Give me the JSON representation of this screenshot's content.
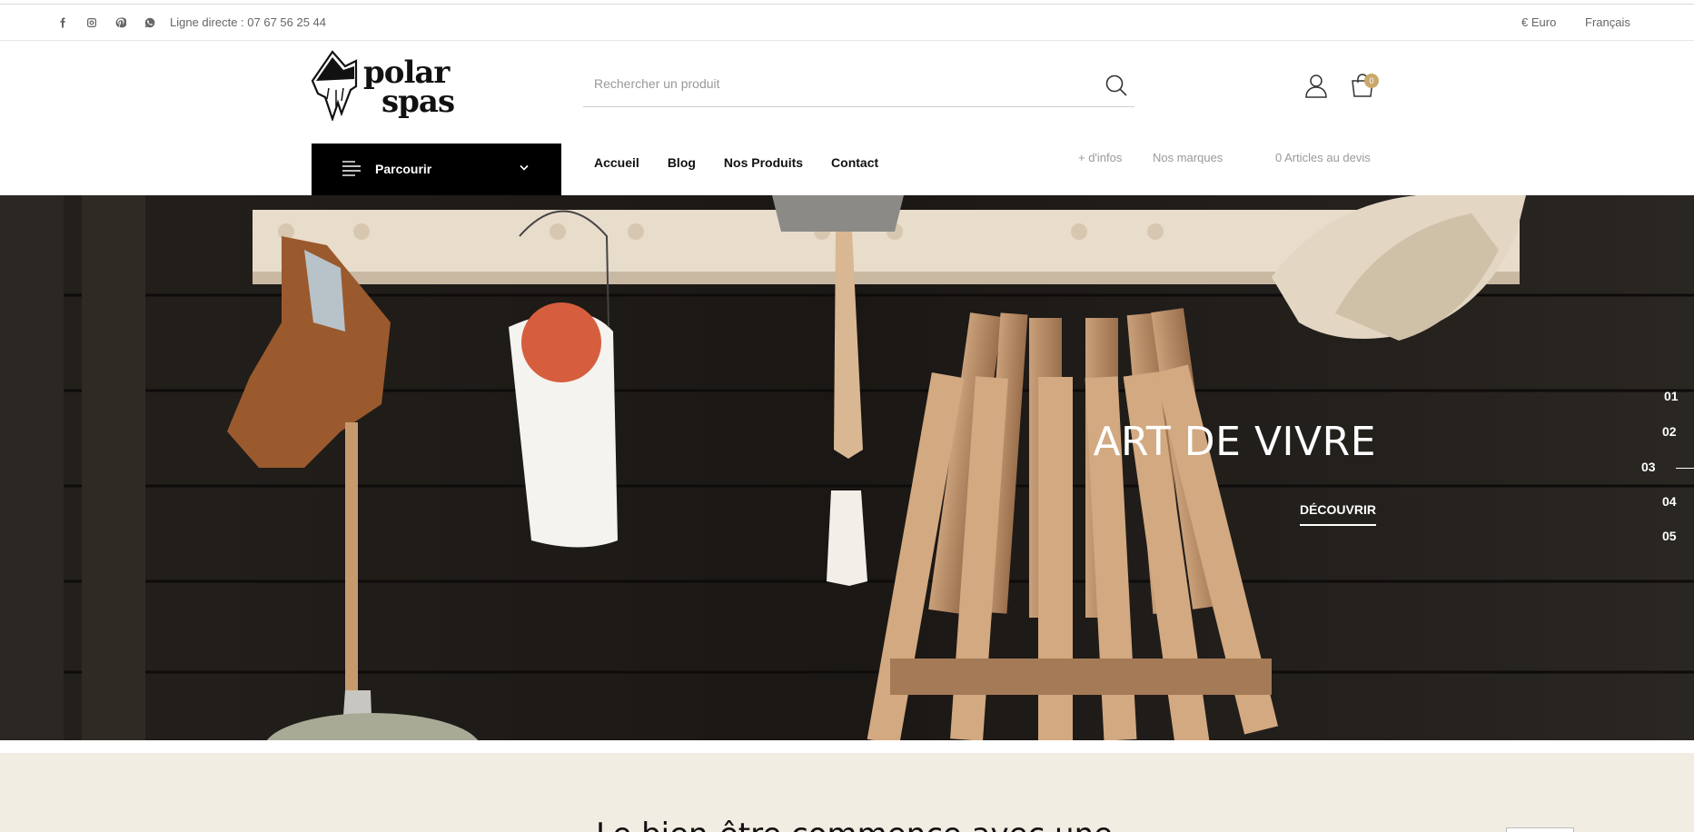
{
  "topbar": {
    "social_icons": [
      "facebook-icon",
      "instagram-icon",
      "pinterest-icon",
      "whatsapp-icon"
    ],
    "phone": "Ligne directe : 07 67 56 25 44",
    "currency": "€ Euro",
    "language": "Français"
  },
  "header": {
    "logo_text": "polar spas",
    "search_placeholder": "Rechercher un produit",
    "cart_count": "0"
  },
  "nav": {
    "browse_label": "Parcourir",
    "items": [
      "Accueil",
      "Blog",
      "Nos Produits",
      "Contact"
    ],
    "more_info": "+ d'infos",
    "brands": "Nos marques",
    "quote": "0 Articles au devis"
  },
  "hero": {
    "title": "ART DE VIVRE",
    "cta": "DÉCOUVRIR",
    "slides": [
      "01",
      "02",
      "03",
      "04",
      "05"
    ],
    "active_slide": "03"
  },
  "intro": {
    "heading": "Le bien-être commence avec une"
  },
  "colors": {
    "accent": "#c9a86a",
    "browse_bg": "#000000",
    "cream_bg": "#f1ede3"
  }
}
